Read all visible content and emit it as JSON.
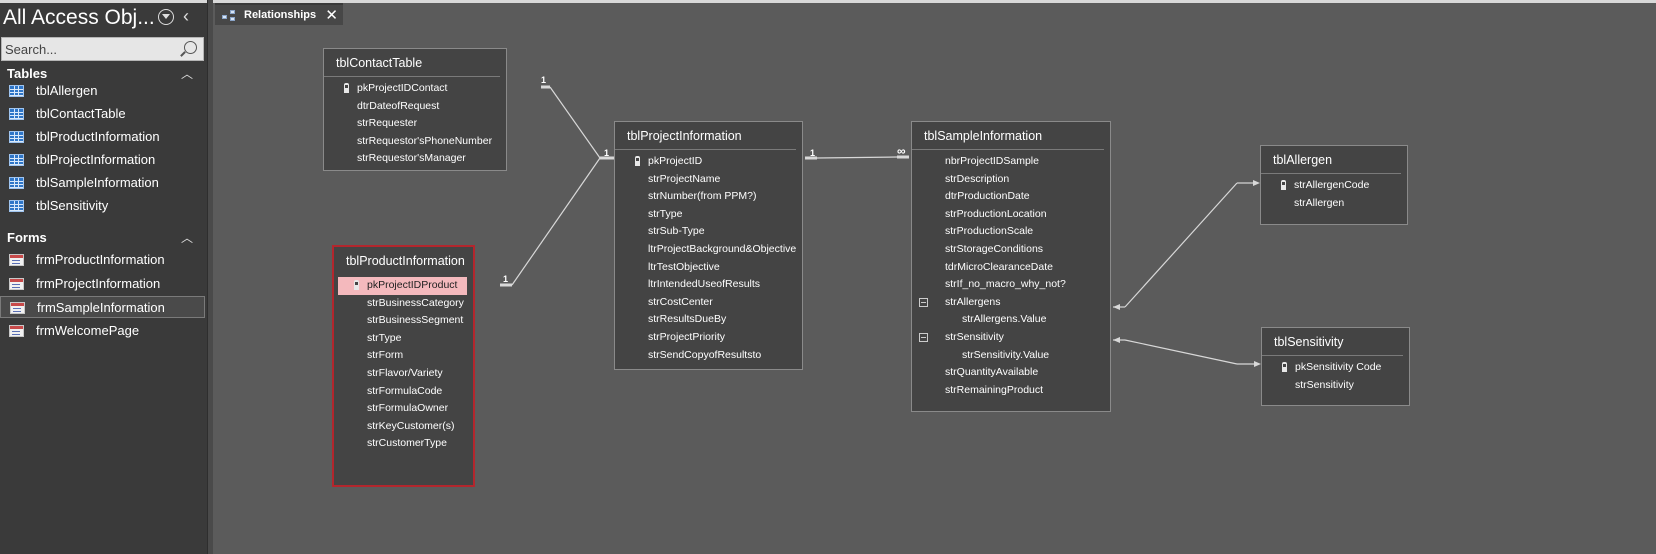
{
  "nav": {
    "title": "All Access Obj...",
    "search_placeholder": "Search...",
    "groups": [
      {
        "label": "Tables",
        "items": [
          "tblAllergen",
          "tblContactTable",
          "tblProductInformation",
          "tblProjectInformation",
          "tblSampleInformation",
          "tblSensitivity"
        ]
      },
      {
        "label": "Forms",
        "items": [
          "frmProductInformation",
          "frmProjectInformation",
          "frmSampleInformation",
          "frmWelcomePage"
        ]
      }
    ],
    "selected_item": "frmSampleInformation"
  },
  "tab": {
    "label": "Relationships"
  },
  "tables": [
    {
      "name": "tblContactTable",
      "fields": [
        "pkProjectIDContact",
        "dtrDateofRequest",
        "strRequester",
        "strRequestor'sPhoneNumber",
        "strRequestor'sManager"
      ]
    },
    {
      "name": "tblProductInformation",
      "fields": [
        "pkProjectIDProduct",
        "strBusinessCategory",
        "strBusinessSegment",
        "strType",
        "strForm",
        "strFlavor/Variety",
        "strFormulaCode",
        "strFormulaOwner",
        "strKeyCustomer(s)",
        "strCustomerType"
      ]
    },
    {
      "name": "tblProjectInformation",
      "fields": [
        "pkProjectID",
        "strProjectName",
        "strNumber(from PPM?)",
        "strType",
        "strSub-Type",
        "ltrProjectBackground&Objective",
        "ltrTestObjective",
        "ltrIntendedUseofResults",
        "strCostCenter",
        "strResultsDueBy",
        "strProjectPriority",
        "strSendCopyofResultsto"
      ]
    },
    {
      "name": "tblSampleInformation",
      "fields": [
        "nbrProjectIDSample",
        "strDescription",
        "dtrProductionDate",
        "strProductionLocation",
        "strProductionScale",
        "strStorageConditions",
        "tdrMicroClearanceDate",
        "strIf_no_macro_why_not?",
        "strAllergens",
        "strAllergens.Value",
        "strSensitivity",
        "strSensitivity.Value",
        "strQuantityAvailable",
        "strRemainingProduct"
      ]
    },
    {
      "name": "tblAllergen",
      "fields": [
        "strAllergenCode",
        "strAllergen"
      ]
    },
    {
      "name": "tblSensitivity",
      "fields": [
        "pkSensitivity Code",
        "strSensitivity"
      ]
    }
  ],
  "relationship_labels": {
    "one": "1",
    "many": "∞"
  }
}
